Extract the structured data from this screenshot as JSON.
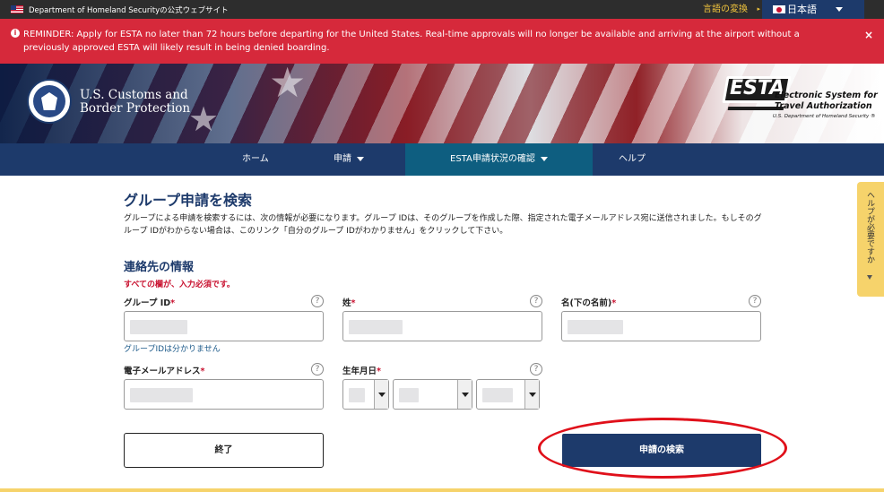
{
  "topbar": {
    "official_site": "Department of Homeland Securityの公式ウェブサイト",
    "translate": "言語の変換",
    "language": "日本語"
  },
  "alert": {
    "message": "REMINDER: Apply for ESTA no later than 72 hours before departing for the United States. Real-time approvals will no longer be available and arriving at the airport without a previously approved ESTA will likely result in being denied boarding.",
    "close": "×"
  },
  "header": {
    "agency_line1": "U.S. Customs and",
    "agency_line2": "Border Protection",
    "esta": "ESTA",
    "esta_line1": "Electronic System for",
    "esta_line2": "Travel Authorization",
    "esta_sub": "U.S. Department of Homeland Security ®"
  },
  "nav": {
    "home": "ホーム",
    "apply": "申請",
    "status": "ESTA申請状況の確認",
    "help": "ヘルプ"
  },
  "main": {
    "title": "グループ申請を検索",
    "intro": "グループによる申請を検索するには、次の情報が必要になります。グループ IDは、そのグループを作成した際、指定された電子メールアドレス宛に送信されました。もしそのグループ IDがわからない場合は、このリンク「自分のグループ IDがわかりません」をクリックして下さい。",
    "section_title": "連絡先の情報",
    "required_note": "すべての欄が、入力必須です。"
  },
  "form": {
    "group_id_label": "グループ ID",
    "surname_label": "姓",
    "given_name_label": "名(下の名前)",
    "email_label": "電子メールアドレス",
    "dob_label": "生年月日",
    "required_mark": "*",
    "help_mark": "?",
    "group_id_hint": "グループIDは分かりません"
  },
  "buttons": {
    "exit": "終了",
    "search": "申請の検索"
  },
  "help_tab": "ヘルプが必要ですか",
  "colors": {
    "navy": "#1d3a6b",
    "alert_red": "#d6293b",
    "active_tab": "#0e5e80",
    "help_tab": "#f6d36b",
    "annotation_red": "#e0101a"
  }
}
